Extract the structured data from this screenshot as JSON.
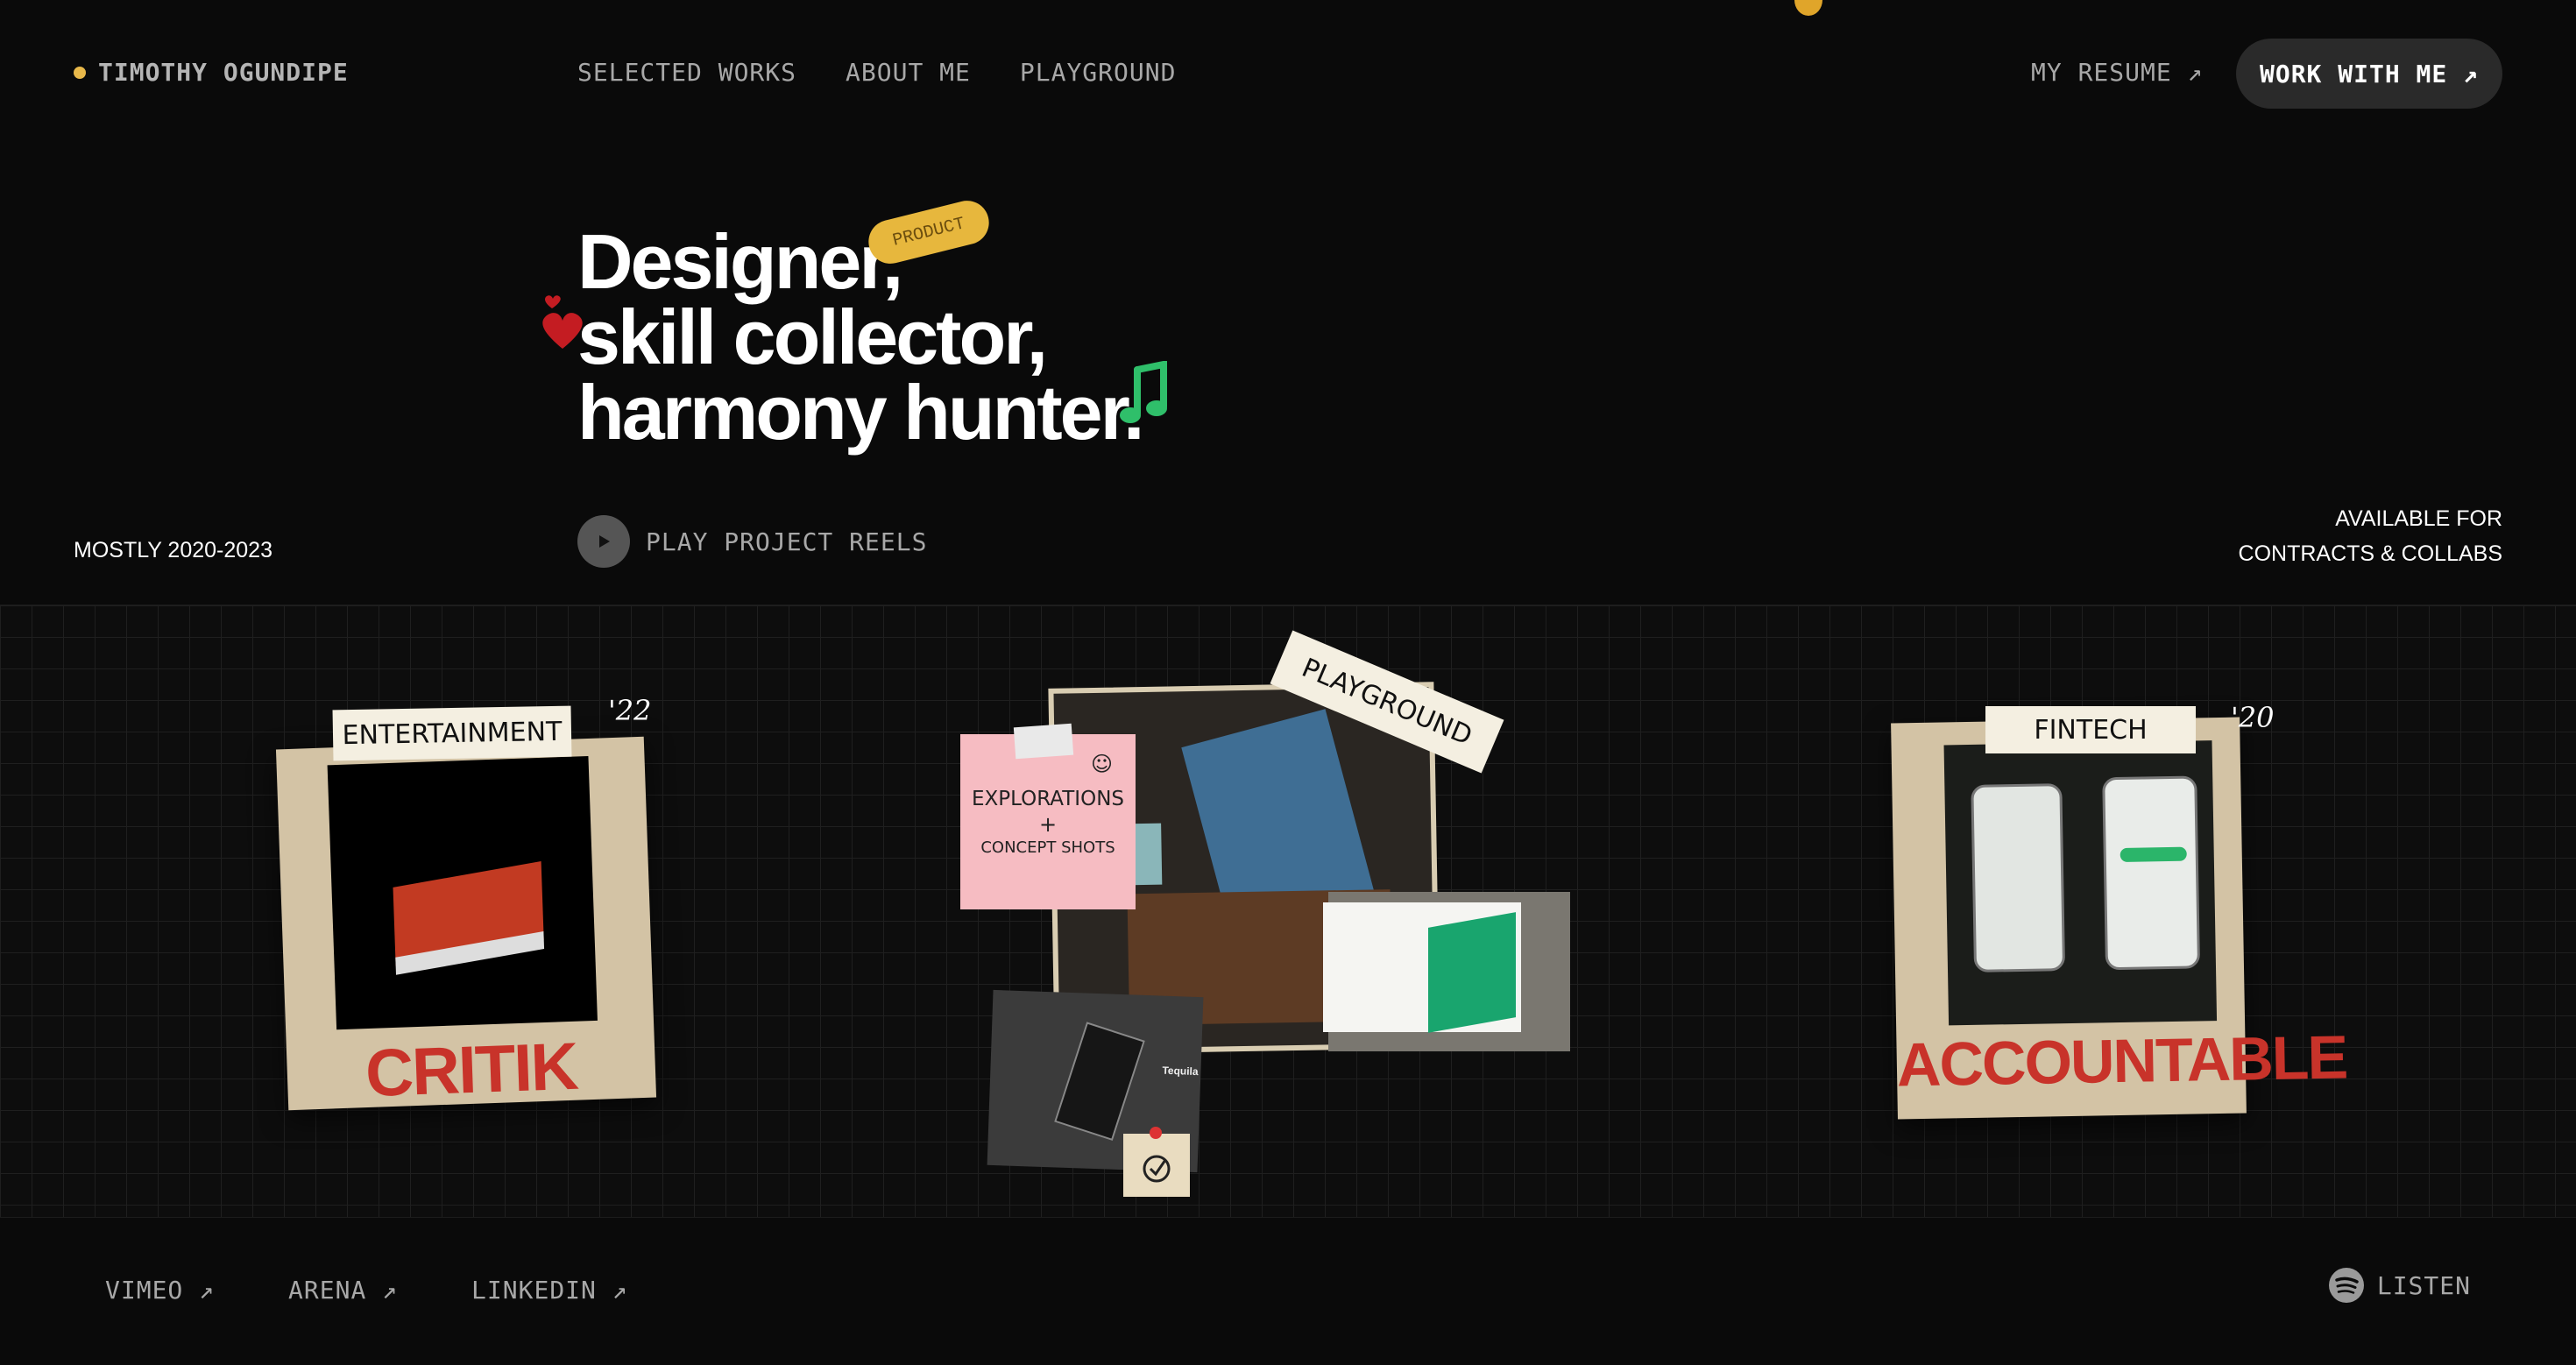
{
  "header": {
    "logo_name": "TIMOTHY OGUNDIPE",
    "nav": [
      "SELECTED WORKS",
      "ABOUT ME",
      "PLAYGROUND"
    ],
    "resume_label": "MY RESUME ↗",
    "cta_label": "WORK WITH ME ↗"
  },
  "hero": {
    "tag": "PRODUCT",
    "lines": [
      "Designer,",
      "skill collector,",
      "harmony hunter."
    ],
    "play_label": "PLAY PROJECT REELS",
    "period": "MOSTLY 2020-2023",
    "availability": [
      "AVAILABLE FOR",
      "CONTRACTS & COLLABS"
    ]
  },
  "projects": [
    {
      "category": "ENTERTAINMENT",
      "year": "'22",
      "name": "CRITIK"
    },
    {
      "category": "PLAYGROUND",
      "note": [
        "EXPLORATIONS",
        "+",
        "CONCEPT SHOTS"
      ],
      "mock_word": "Tequila"
    },
    {
      "category": "FINTECH",
      "year": "'20",
      "name": "ACCOUNTABLE"
    }
  ],
  "footer": {
    "links": [
      "VIMEO ↗",
      "ARENA ↗",
      "LINKEDIN ↗"
    ],
    "listen_label": "LISTEN"
  },
  "colors": {
    "accent": "#e8b84a",
    "label_red": "#c8332a",
    "note_pink": "#f6bcc2",
    "spotify_grey": "#9a9a9a"
  },
  "icons": [
    "status-dot",
    "arrow-up-right-icon",
    "heart-icon",
    "music-note-icon",
    "play-icon",
    "spotify-icon"
  ]
}
